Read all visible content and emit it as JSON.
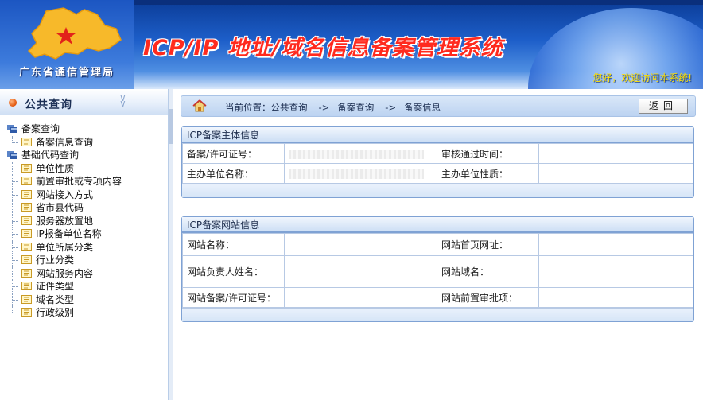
{
  "header": {
    "org_name": "广东省通信管理局",
    "system_title": "ICP/IP 地址/域名信息备案管理系统",
    "welcome": "您好，欢迎访问本系统!"
  },
  "sidebar": {
    "title": "公共查询",
    "groups": [
      {
        "label": "备案查询",
        "items": [
          "备案信息查询"
        ]
      },
      {
        "label": "基础代码查询",
        "items": [
          "单位性质",
          "前置审批或专项内容",
          "网站接入方式",
          "省市县代码",
          "服务器放置地",
          "IP报备单位名称",
          "单位所属分类",
          "行业分类",
          "网站服务内容",
          "证件类型",
          "域名类型",
          "行政级别"
        ]
      }
    ]
  },
  "breadcrumb": {
    "prefix": "当前位置：",
    "parts": [
      "公共查询",
      "备案查询",
      "备案信息"
    ],
    "separator": "->",
    "back_label": "返回"
  },
  "panel_subject": {
    "title": "ICP备案主体信息",
    "rows": [
      {
        "l1": "备案/许可证号：",
        "v1": "",
        "l2": "审核通过时间：",
        "v2": ""
      },
      {
        "l1": "主办单位名称：",
        "v1": "",
        "l2": "主办单位性质：",
        "v2": ""
      }
    ]
  },
  "panel_site": {
    "title": "ICP备案网站信息",
    "rows": [
      {
        "l1": "网站名称：",
        "v1": "",
        "l2": "网站首页网址：",
        "v2": ""
      },
      {
        "l1": "网站负责人姓名：",
        "v1": "",
        "l2": "网站域名：",
        "v2": ""
      },
      {
        "l1": "网站备案/许可证号：",
        "v1": "",
        "l2": "网站前置审批项：",
        "v2": ""
      }
    ]
  },
  "colors": {
    "accent": "#1d5ec9",
    "title_red": "#ff2a1e",
    "welcome_yellow": "#ffe000",
    "panel_border": "#7fa2d4"
  }
}
